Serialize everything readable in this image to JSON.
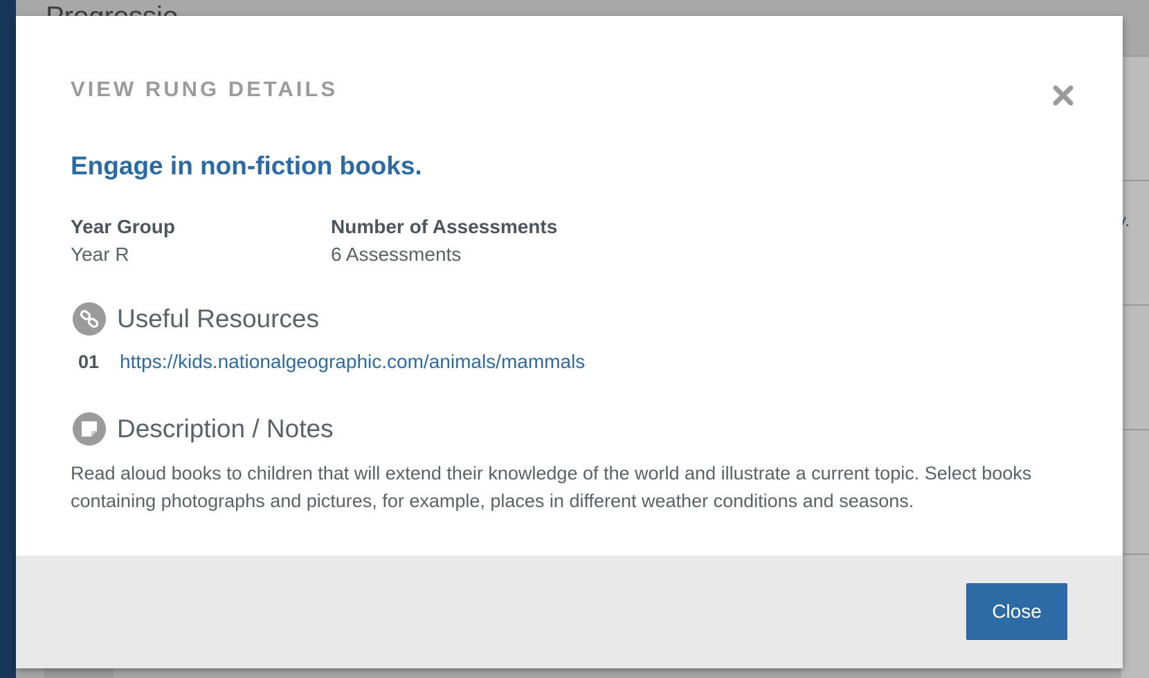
{
  "background": {
    "page_heading_fragment": "Progressio",
    "text_fragment": "y."
  },
  "modal": {
    "title": "VIEW RUNG DETAILS",
    "close_icon": "close-x-icon",
    "rung_name": "Engage in non-fiction books.",
    "year_group": {
      "label": "Year Group",
      "value": "Year R"
    },
    "assessments": {
      "label": "Number of Assessments",
      "value": "6 Assessments"
    },
    "resources": {
      "icon": "link-icon",
      "title": "Useful Resources",
      "items": [
        {
          "number": "01",
          "url": "https://kids.nationalgeographic.com/animals/mammals"
        }
      ]
    },
    "notes": {
      "icon": "sticky-note-icon",
      "title": "Description / Notes",
      "text": "Read aloud books to children that will extend their knowledge of the world and illustrate a current topic. Select books containing photographs and pictures, for example, places in different weather conditions and seasons."
    },
    "footer": {
      "close_label": "Close"
    }
  },
  "colors": {
    "accent": "#2c6aa3",
    "title_gray": "#9b9b9b",
    "body_text": "#5b6168",
    "footer_bg": "#e9e9e9",
    "sidebar": "#16375a",
    "overlay": "#a8a8a8"
  }
}
